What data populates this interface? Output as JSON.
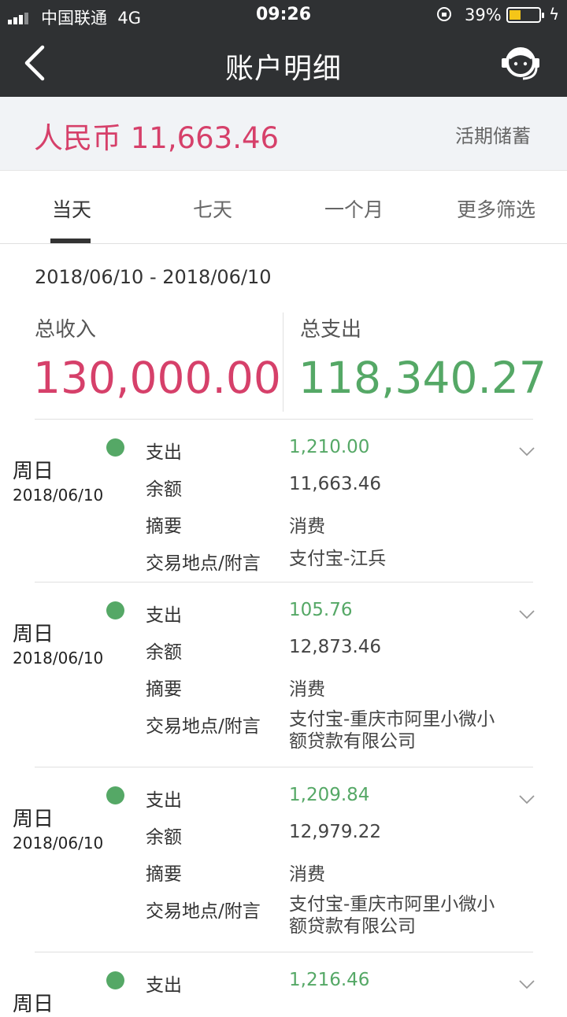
{
  "status_bar": {
    "carrier": "中国联通  4G",
    "time": "09:26",
    "battery": "39%",
    "battery_level": 0.39
  },
  "nav": {
    "title": "账户明细"
  },
  "balance": {
    "text": "人民币 11,663.46",
    "account_type": "活期储蓄"
  },
  "tabs": [
    {
      "label": "当天",
      "active": true
    },
    {
      "label": "七天",
      "active": false
    },
    {
      "label": "一个月",
      "active": false
    },
    {
      "label": "更多筛选",
      "active": false
    }
  ],
  "summary": {
    "date_range": "2018/06/10 - 2018/06/10",
    "income_label": "总收入",
    "income_value": "130,000.00",
    "expense_label": "总支出",
    "expense_value": "118,340.27"
  },
  "labels": {
    "type": "支出",
    "balance": "余额",
    "memo": "摘要",
    "location": "交易地点/附言"
  },
  "records": [
    {
      "weekday": "周日",
      "date": "2018/06/10",
      "amount": "1,210.00",
      "balance": "11,663.46",
      "memo": "消费",
      "location": "支付宝-江兵"
    },
    {
      "weekday": "周日",
      "date": "2018/06/10",
      "amount": "105.76",
      "balance": "12,873.46",
      "memo": "消费",
      "location": "支付宝-重庆市阿里小微小额贷款有限公司"
    },
    {
      "weekday": "周日",
      "date": "2018/06/10",
      "amount": "1,209.84",
      "balance": "12,979.22",
      "memo": "消费",
      "location": "支付宝-重庆市阿里小微小额贷款有限公司"
    },
    {
      "weekday": "周日",
      "date": "",
      "amount": "1,216.46",
      "balance": "",
      "memo": "",
      "location": ""
    }
  ],
  "colors": {
    "income": "#d6406a",
    "expense": "#55a866",
    "nav_bg": "#2f3133",
    "header_bg": "#f1f3f6"
  }
}
